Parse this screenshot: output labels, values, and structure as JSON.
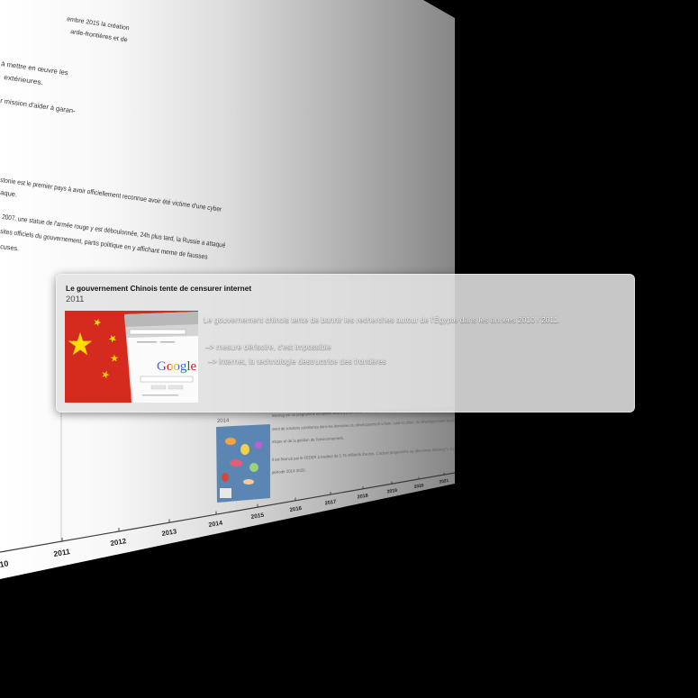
{
  "colors": {
    "background": "#000000",
    "flag_red": "#d52b1e",
    "flag_star": "#ffde00",
    "map_blue": "#5b86b3"
  },
  "panel": {
    "text_lines": [
      "embre 2015 la création",
      "arde-frontières et de",
      "à mettre en œuvre les",
      "extérieures.",
      "r mission d'aider à garan-",
      "stonie est le premier pays à avoir officiellement reconnue avoir été victime d'une cyber",
      "aque.",
      "2007, une statue de l'armée rouge y est déboulonnée, 24h plus tard, la Russie a attaqué",
      "sites officiels du gouvernement, partis politique en y affichant meme de fausses",
      "cuses."
    ]
  },
  "background_event": {
    "year": "2014",
    "lines": [
      "Interreg est un programme européen visant à promouvoir la coopération entre les régions européennes et le développe-",
      "ment de solutions communes dans les domaines du développement urbain, rural et côtier, du développement écono-",
      "mique et de la gestion de l'environnement.",
      "Il est financé par le FEDER à hauteur de 1,75 milliards d'euros. L'actuel programme se dénomme Interreg V. Il couvre la",
      "période 2014-2020."
    ]
  },
  "timeline": {
    "years": [
      "10",
      "2011",
      "2012",
      "2013",
      "2014",
      "2015",
      "2016",
      "2017",
      "2018",
      "2019",
      "2020",
      "2021"
    ]
  },
  "event": {
    "title": "Le gouvernement Chinois tente de censurer internet",
    "year": "2011",
    "description": "Le gouvernement chinois tente de bannir les recherches autour de l'Égypte dans les années 2010 / 2011.",
    "points": [
      "–> mesure dérisoire, c'est impossible",
      "–> internet, la technologie destructrice des frontières"
    ],
    "image_logo": "Google"
  }
}
